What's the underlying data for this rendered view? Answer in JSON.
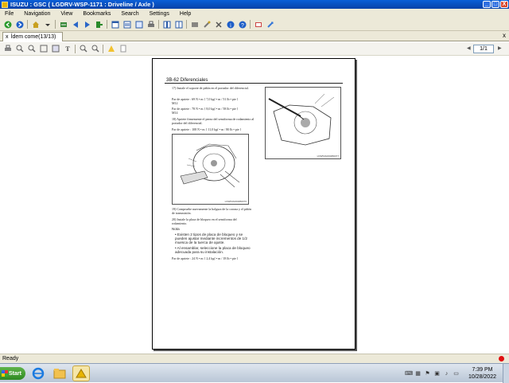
{
  "window": {
    "title": "ISUZU : GSC ( LGDRV-WSP-1171 : Driveline / Axle )",
    "minimize_glyph": "_",
    "maximize_glyph": "□",
    "close_glyph": "X"
  },
  "menu": {
    "items": [
      "File",
      "Navigation",
      "View",
      "Bookmarks",
      "Search",
      "Settings",
      "Help"
    ]
  },
  "toolbar": {
    "icons": [
      "back-icon",
      "forward-icon",
      "home-icon",
      "dropdown-icon",
      "bookmark-icon",
      "prev-icon",
      "next-icon",
      "exit-icon",
      "document-icon",
      "list-icon",
      "window-icon",
      "print-icon",
      "tile-icon",
      "cascade-icon",
      "stack-icon",
      "tools-icon",
      "info-icon",
      "help-icon",
      "settings-icon",
      "zoom-icon"
    ]
  },
  "tab": {
    "label": "Ídem come(13/13)",
    "close_glyph": "x",
    "panel_close_glyph": "x"
  },
  "doc_toolbar": {
    "page_indicator": "1/1",
    "prev_glyph": "◀",
    "next_glyph": "▶"
  },
  "document": {
    "header": "3B-62  Diferenciales",
    "blocks": [
      {
        "num": "17)",
        "text": "Instale el soporte de piñón en el portador del diferencial."
      },
      {
        "num": "",
        "text": "Par de apriete :  69 N • m { 7,0 kgf • m / 51 lb • pie }"
      },
      {
        "num": "",
        "text": "M12"
      },
      {
        "num": "",
        "text": "Par de apriete :  78 N • m { 8,0 kgf • m / 58 lb • pie }"
      },
      {
        "num": "",
        "text": "M14"
      },
      {
        "num": "18)",
        "text": "Apriete firmemente el perno del semiforma de rodamiento al portador del diferencial."
      },
      {
        "num": "",
        "text": "Par de apriete :  108 N • m { 11,0 kgf • m / 80 lb • pie }"
      }
    ],
    "blocks2": [
      {
        "num": "19)",
        "text": "Compruebe nuevamente la holgura de la corona y el piñón de transmisión."
      },
      {
        "num": "20)",
        "text": "Instale la placa de bloqueo en el semiforma del rodamiento."
      }
    ],
    "note_title": "Nota",
    "note_items": [
      "Existen 2 tipos de placa de bloqueo y se pueden ajustar mediante incrementos de 1/2 muesca de la tuerca de ajuste.",
      "Al ensamblar, seleccione la placa de bloqueo adecuada para su instalación."
    ],
    "final_torque": "Par de apriete :  24 N • m { 2,4 kgf • m / 18 lb • pie }",
    "fig1_code": "LNW53A0004B0076",
    "fig2_code": "LNW53A0004B0077"
  },
  "status": {
    "text": "Ready"
  },
  "taskbar": {
    "start_label": "Start",
    "time": "7:39 PM",
    "date": "10/28/2022"
  }
}
